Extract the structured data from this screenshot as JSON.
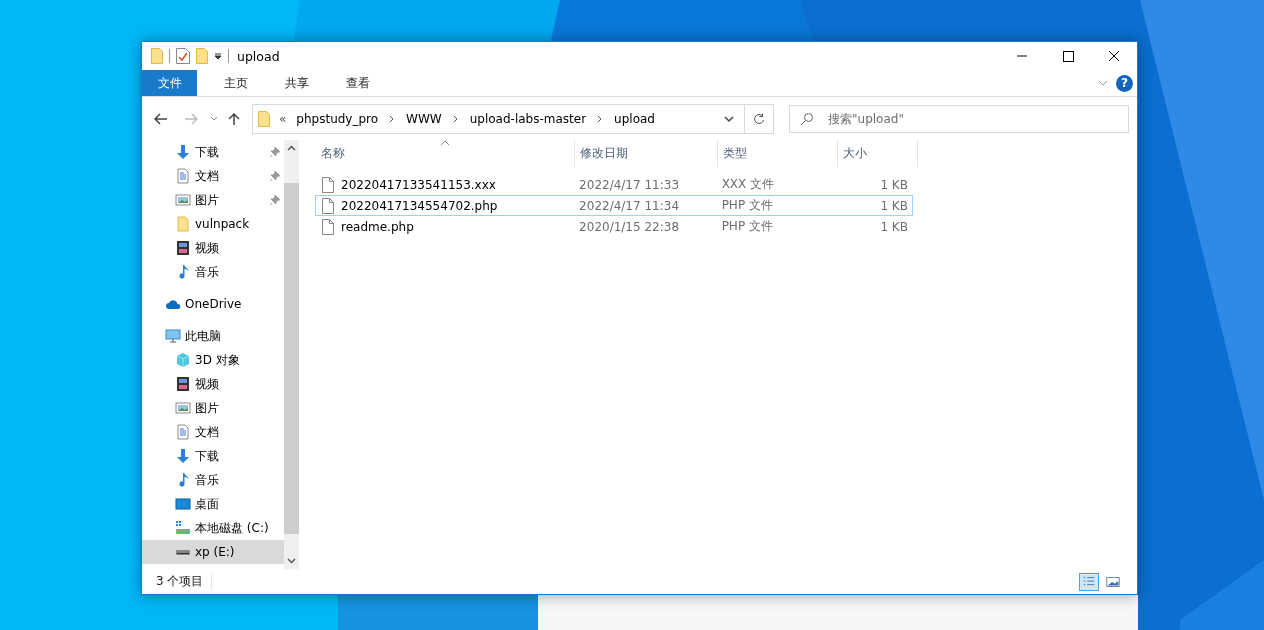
{
  "window": {
    "title": "upload",
    "help_label": "?"
  },
  "ribbon_tabs": [
    {
      "label": "文件",
      "selected": true
    },
    {
      "label": "主页",
      "selected": false
    },
    {
      "label": "共享",
      "selected": false
    },
    {
      "label": "查看",
      "selected": false
    }
  ],
  "address_bar": {
    "overflow_mark": "«",
    "path": [
      "phpstudy_pro",
      "WWW",
      "upload-labs-master",
      "upload"
    ]
  },
  "search": {
    "placeholder": "搜索\"upload\""
  },
  "quick_access": [
    {
      "label": "下载",
      "kind": "download",
      "pinned": true,
      "selected": false
    },
    {
      "label": "文档",
      "kind": "document",
      "pinned": true,
      "selected": false
    },
    {
      "label": "图片",
      "kind": "picture",
      "pinned": true,
      "selected": false
    },
    {
      "label": "vulnpack",
      "kind": "folder",
      "pinned": false,
      "selected": false
    },
    {
      "label": "视频",
      "kind": "video",
      "pinned": false,
      "selected": false
    },
    {
      "label": "音乐",
      "kind": "music",
      "pinned": false,
      "selected": false
    }
  ],
  "sidebar": [
    {
      "label": "OneDrive",
      "kind": "cloud",
      "selected": false
    },
    {
      "label": "此电脑",
      "kind": "pc",
      "selected": false,
      "children": [
        {
          "label": "3D 对象",
          "kind": "cube",
          "selected": false
        },
        {
          "label": "视频",
          "kind": "video",
          "selected": false
        },
        {
          "label": "图片",
          "kind": "picture",
          "selected": false
        },
        {
          "label": "文档",
          "kind": "document",
          "selected": false
        },
        {
          "label": "下载",
          "kind": "download",
          "selected": false
        },
        {
          "label": "音乐",
          "kind": "music",
          "selected": false
        },
        {
          "label": "桌面",
          "kind": "desktop",
          "selected": false
        },
        {
          "label": "本地磁盘 (C:)",
          "kind": "system_drive",
          "selected": false
        },
        {
          "label": "xp (E:)",
          "kind": "drive",
          "selected": true
        }
      ]
    }
  ],
  "columns": [
    {
      "label": "名称",
      "sorted": true
    },
    {
      "label": "修改日期",
      "sorted": false
    },
    {
      "label": "类型",
      "sorted": false
    },
    {
      "label": "大小",
      "sorted": false
    }
  ],
  "files": [
    {
      "name": "20220417133541153.xxx",
      "modified": "2022/4/17 11:33",
      "type": "XXX 文件",
      "size": "1 KB",
      "selected": false
    },
    {
      "name": "20220417134554702.php",
      "modified": "2022/4/17 11:34",
      "type": "PHP 文件",
      "size": "1 KB",
      "selected": true
    },
    {
      "name": "readme.php",
      "modified": "2020/1/15 22:38",
      "type": "PHP 文件",
      "size": "1 KB",
      "selected": false
    }
  ],
  "status_bar": {
    "item_count": "3 个项目"
  },
  "view_buttons": [
    {
      "kind": "details",
      "selected": true
    },
    {
      "kind": "large_icons",
      "selected": false
    }
  ]
}
